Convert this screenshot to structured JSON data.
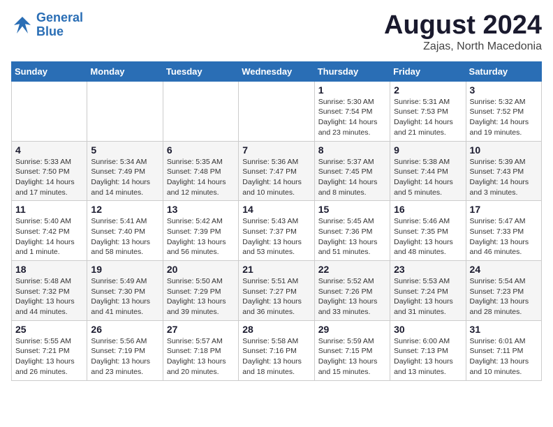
{
  "logo": {
    "line1": "General",
    "line2": "Blue"
  },
  "header": {
    "month": "August 2024",
    "location": "Zajas, North Macedonia"
  },
  "weekdays": [
    "Sunday",
    "Monday",
    "Tuesday",
    "Wednesday",
    "Thursday",
    "Friday",
    "Saturday"
  ],
  "weeks": [
    [
      null,
      null,
      null,
      null,
      {
        "day": "1",
        "sunrise": "Sunrise: 5:30 AM",
        "sunset": "Sunset: 7:54 PM",
        "daylight": "Daylight: 14 hours and 23 minutes."
      },
      {
        "day": "2",
        "sunrise": "Sunrise: 5:31 AM",
        "sunset": "Sunset: 7:53 PM",
        "daylight": "Daylight: 14 hours and 21 minutes."
      },
      {
        "day": "3",
        "sunrise": "Sunrise: 5:32 AM",
        "sunset": "Sunset: 7:52 PM",
        "daylight": "Daylight: 14 hours and 19 minutes."
      }
    ],
    [
      {
        "day": "4",
        "sunrise": "Sunrise: 5:33 AM",
        "sunset": "Sunset: 7:50 PM",
        "daylight": "Daylight: 14 hours and 17 minutes."
      },
      {
        "day": "5",
        "sunrise": "Sunrise: 5:34 AM",
        "sunset": "Sunset: 7:49 PM",
        "daylight": "Daylight: 14 hours and 14 minutes."
      },
      {
        "day": "6",
        "sunrise": "Sunrise: 5:35 AM",
        "sunset": "Sunset: 7:48 PM",
        "daylight": "Daylight: 14 hours and 12 minutes."
      },
      {
        "day": "7",
        "sunrise": "Sunrise: 5:36 AM",
        "sunset": "Sunset: 7:47 PM",
        "daylight": "Daylight: 14 hours and 10 minutes."
      },
      {
        "day": "8",
        "sunrise": "Sunrise: 5:37 AM",
        "sunset": "Sunset: 7:45 PM",
        "daylight": "Daylight: 14 hours and 8 minutes."
      },
      {
        "day": "9",
        "sunrise": "Sunrise: 5:38 AM",
        "sunset": "Sunset: 7:44 PM",
        "daylight": "Daylight: 14 hours and 5 minutes."
      },
      {
        "day": "10",
        "sunrise": "Sunrise: 5:39 AM",
        "sunset": "Sunset: 7:43 PM",
        "daylight": "Daylight: 14 hours and 3 minutes."
      }
    ],
    [
      {
        "day": "11",
        "sunrise": "Sunrise: 5:40 AM",
        "sunset": "Sunset: 7:42 PM",
        "daylight": "Daylight: 14 hours and 1 minute."
      },
      {
        "day": "12",
        "sunrise": "Sunrise: 5:41 AM",
        "sunset": "Sunset: 7:40 PM",
        "daylight": "Daylight: 13 hours and 58 minutes."
      },
      {
        "day": "13",
        "sunrise": "Sunrise: 5:42 AM",
        "sunset": "Sunset: 7:39 PM",
        "daylight": "Daylight: 13 hours and 56 minutes."
      },
      {
        "day": "14",
        "sunrise": "Sunrise: 5:43 AM",
        "sunset": "Sunset: 7:37 PM",
        "daylight": "Daylight: 13 hours and 53 minutes."
      },
      {
        "day": "15",
        "sunrise": "Sunrise: 5:45 AM",
        "sunset": "Sunset: 7:36 PM",
        "daylight": "Daylight: 13 hours and 51 minutes."
      },
      {
        "day": "16",
        "sunrise": "Sunrise: 5:46 AM",
        "sunset": "Sunset: 7:35 PM",
        "daylight": "Daylight: 13 hours and 48 minutes."
      },
      {
        "day": "17",
        "sunrise": "Sunrise: 5:47 AM",
        "sunset": "Sunset: 7:33 PM",
        "daylight": "Daylight: 13 hours and 46 minutes."
      }
    ],
    [
      {
        "day": "18",
        "sunrise": "Sunrise: 5:48 AM",
        "sunset": "Sunset: 7:32 PM",
        "daylight": "Daylight: 13 hours and 44 minutes."
      },
      {
        "day": "19",
        "sunrise": "Sunrise: 5:49 AM",
        "sunset": "Sunset: 7:30 PM",
        "daylight": "Daylight: 13 hours and 41 minutes."
      },
      {
        "day": "20",
        "sunrise": "Sunrise: 5:50 AM",
        "sunset": "Sunset: 7:29 PM",
        "daylight": "Daylight: 13 hours and 39 minutes."
      },
      {
        "day": "21",
        "sunrise": "Sunrise: 5:51 AM",
        "sunset": "Sunset: 7:27 PM",
        "daylight": "Daylight: 13 hours and 36 minutes."
      },
      {
        "day": "22",
        "sunrise": "Sunrise: 5:52 AM",
        "sunset": "Sunset: 7:26 PM",
        "daylight": "Daylight: 13 hours and 33 minutes."
      },
      {
        "day": "23",
        "sunrise": "Sunrise: 5:53 AM",
        "sunset": "Sunset: 7:24 PM",
        "daylight": "Daylight: 13 hours and 31 minutes."
      },
      {
        "day": "24",
        "sunrise": "Sunrise: 5:54 AM",
        "sunset": "Sunset: 7:23 PM",
        "daylight": "Daylight: 13 hours and 28 minutes."
      }
    ],
    [
      {
        "day": "25",
        "sunrise": "Sunrise: 5:55 AM",
        "sunset": "Sunset: 7:21 PM",
        "daylight": "Daylight: 13 hours and 26 minutes."
      },
      {
        "day": "26",
        "sunrise": "Sunrise: 5:56 AM",
        "sunset": "Sunset: 7:19 PM",
        "daylight": "Daylight: 13 hours and 23 minutes."
      },
      {
        "day": "27",
        "sunrise": "Sunrise: 5:57 AM",
        "sunset": "Sunset: 7:18 PM",
        "daylight": "Daylight: 13 hours and 20 minutes."
      },
      {
        "day": "28",
        "sunrise": "Sunrise: 5:58 AM",
        "sunset": "Sunset: 7:16 PM",
        "daylight": "Daylight: 13 hours and 18 minutes."
      },
      {
        "day": "29",
        "sunrise": "Sunrise: 5:59 AM",
        "sunset": "Sunset: 7:15 PM",
        "daylight": "Daylight: 13 hours and 15 minutes."
      },
      {
        "day": "30",
        "sunrise": "Sunrise: 6:00 AM",
        "sunset": "Sunset: 7:13 PM",
        "daylight": "Daylight: 13 hours and 13 minutes."
      },
      {
        "day": "31",
        "sunrise": "Sunrise: 6:01 AM",
        "sunset": "Sunset: 7:11 PM",
        "daylight": "Daylight: 13 hours and 10 minutes."
      }
    ]
  ]
}
